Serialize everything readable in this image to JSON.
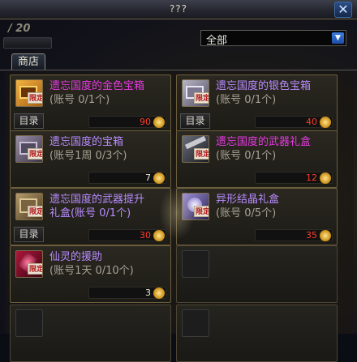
{
  "window": {
    "title": "???",
    "close_label": "✕"
  },
  "header": {
    "counter": "/ 20",
    "tab_label": "商店"
  },
  "filter": {
    "selected": "全部"
  },
  "items": [
    {
      "name_line1": "遗忘国度的金色宝箱",
      "name_line2": "(账号 0/1个)",
      "tag": "限定",
      "catalog": "目录",
      "price": "90",
      "rarity": "pink",
      "icon": "gold-chest-icon"
    },
    {
      "name_line1": "遗忘国度的银色宝箱",
      "name_line2": "(账号 0/1个)",
      "tag": "限定",
      "catalog": "目录",
      "price": "40",
      "rarity": "purple",
      "icon": "silver-chest-icon"
    },
    {
      "name_line1": "遗忘国度的宝箱",
      "name_line2": "(账号1周 0/3个)",
      "tag": "限定",
      "catalog": "",
      "price": "7",
      "rarity": "purple",
      "icon": "chest-icon"
    },
    {
      "name_line1": "遗忘国度的武器礼盒",
      "name_line2": "(账号 0/1个)",
      "tag": "限定",
      "catalog": "",
      "price": "12",
      "rarity": "pink",
      "icon": "weapon-box-icon"
    },
    {
      "name_line1": "遗忘国度的武器提升",
      "name_line2": "礼盒(账号 0/1个)",
      "tag": "限定",
      "catalog": "目录",
      "price": "30",
      "rarity": "purple",
      "icon": "upgrade-box-icon"
    },
    {
      "name_line1": "异形结晶礼盒",
      "name_line2": "(账号 0/5个)",
      "tag": "限定",
      "catalog": "",
      "price": "35",
      "rarity": "purple",
      "icon": "crystal-box-icon"
    },
    {
      "name_line1": "仙灵的援助",
      "name_line2": "(账号1天 0/10个)",
      "tag": "限定",
      "catalog": "",
      "price": "3",
      "rarity": "purple",
      "icon": "fairy-icon"
    }
  ],
  "colors": {
    "pink": "#e53ae0",
    "purple": "#b98cff",
    "price_red": "#ff3b2a",
    "border": "#6d5e3c"
  }
}
